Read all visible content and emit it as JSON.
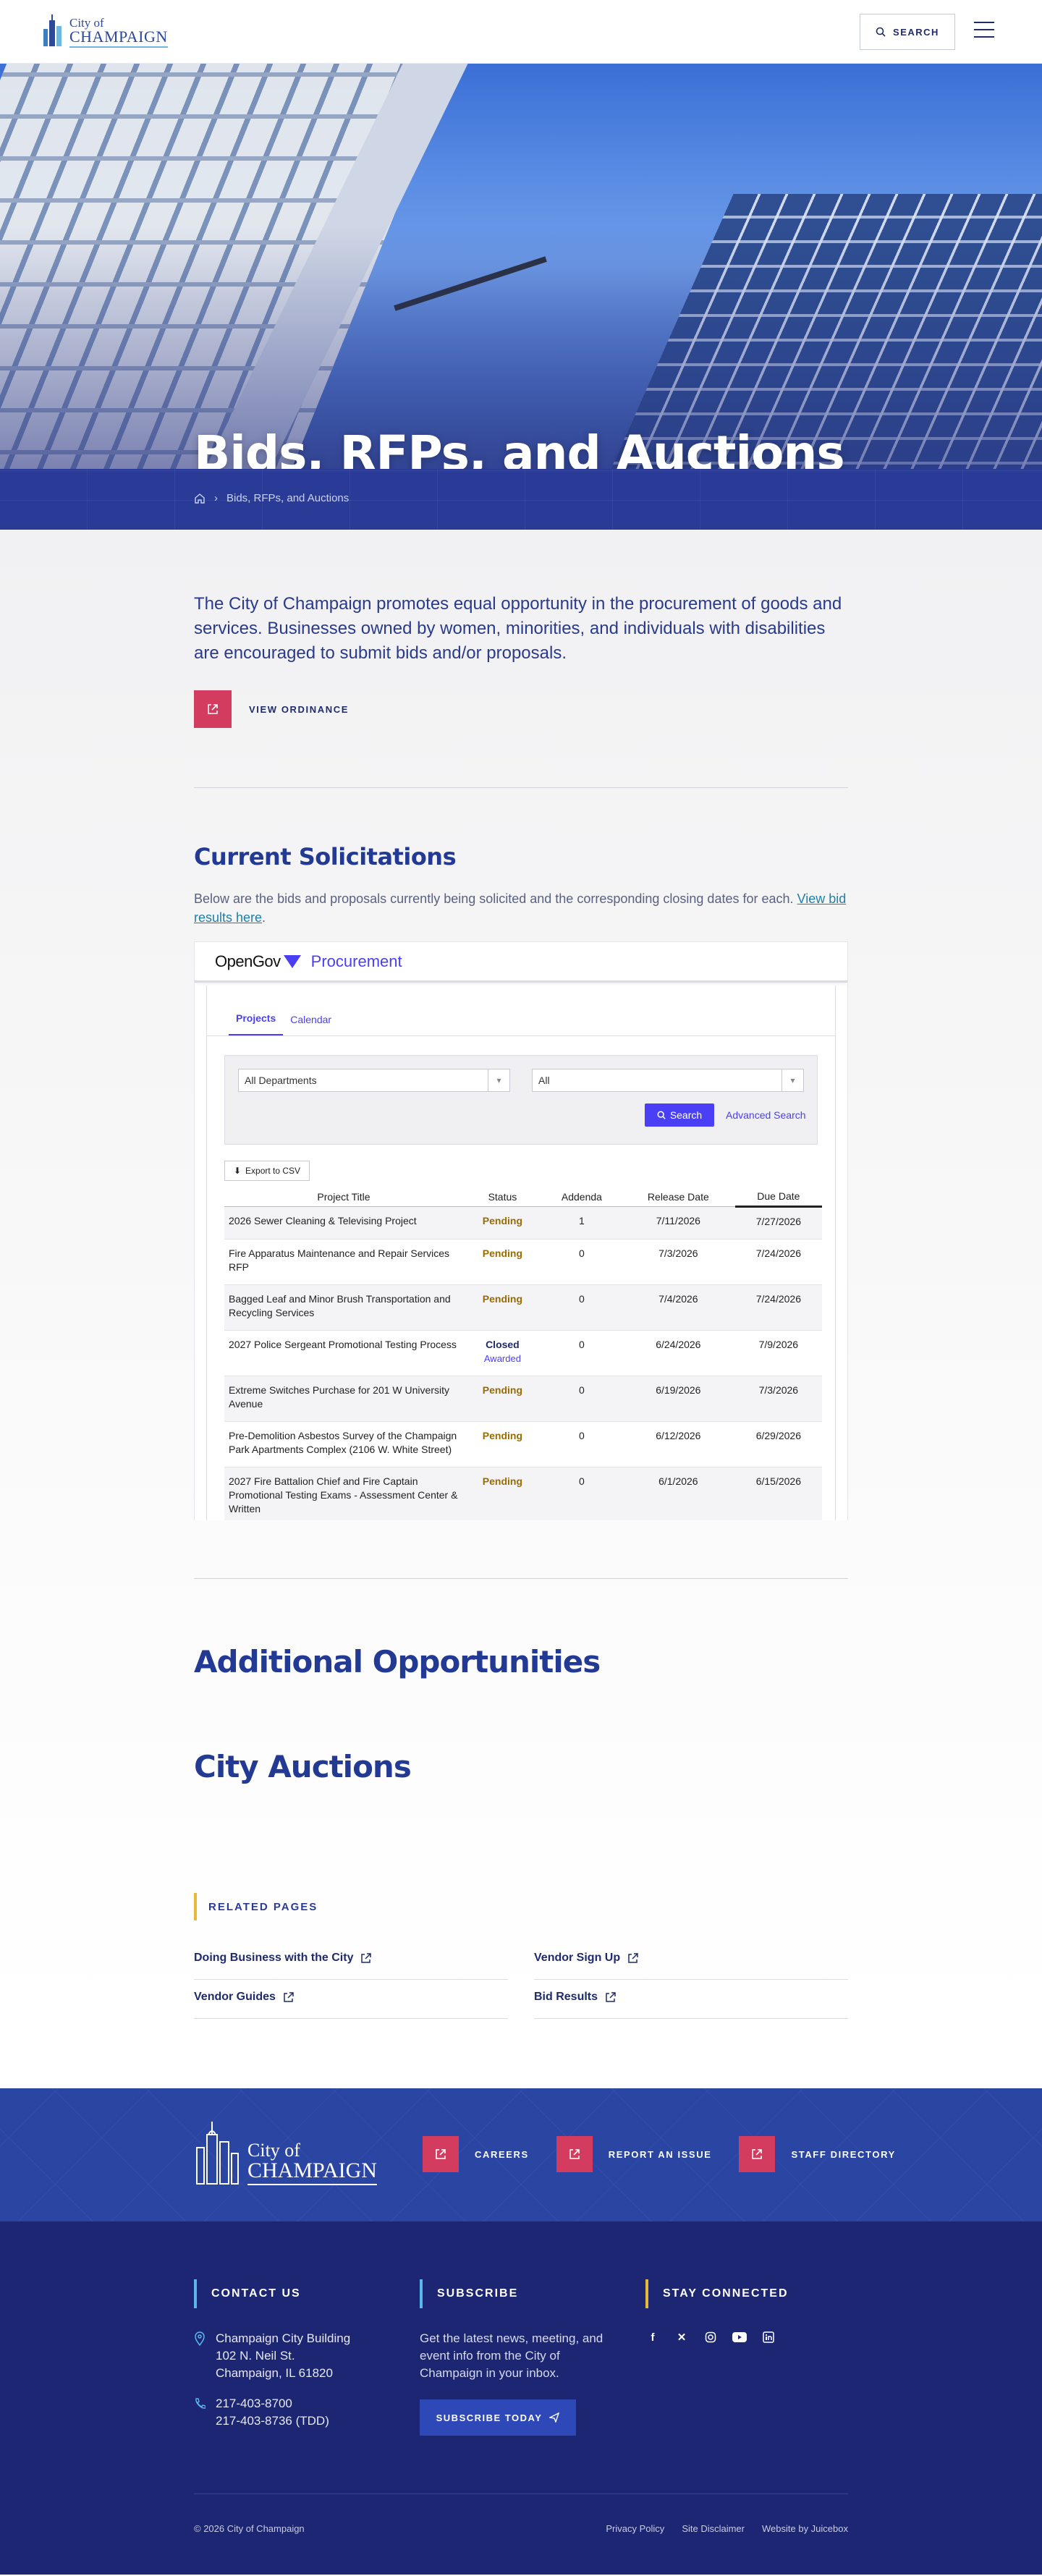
{
  "header": {
    "logo_city": "City of",
    "logo_name": "CHAMPAIGN",
    "search_label": "SEARCH",
    "menu_icon": "hamburger-icon"
  },
  "hero": {
    "title": "Bids, RFPs, and Auctions"
  },
  "breadcrumb": {
    "home_icon": "home-icon",
    "current": "Bids, RFPs, and Auctions"
  },
  "intro": {
    "text": "The City of Champaign promotes equal opportunity in the procurement of goods and services. Businesses owned by women, minorities, and individuals with disabilities are encouraged to submit bids and/or proposals.",
    "ordinance_label": "VIEW ORDINANCE"
  },
  "solicitations": {
    "title": "Current Solicitations",
    "text_before": "Below are the bids and proposals currently being solicited and the corresponding closing dates for each. ",
    "link_text": "View bid results here",
    "text_after": "."
  },
  "opengov": {
    "brand": "OpenGov",
    "product": "Procurement",
    "tabs": [
      "Projects",
      "Calendar"
    ],
    "department_select": "All Departments",
    "status_select": "All",
    "search_label": "Search",
    "advanced_label": "Advanced Search",
    "export_label": "Export to CSV",
    "columns": [
      "Project Title",
      "Status",
      "Addenda",
      "Release Date",
      "Due Date"
    ],
    "rows": [
      {
        "title": "2026 Sewer Cleaning & Televising Project",
        "status": "Pending",
        "sub": "",
        "addenda": "1",
        "release": "7/11/2026",
        "due": "7/27/2026"
      },
      {
        "title": "Fire Apparatus Maintenance and Repair Services RFP",
        "status": "Pending",
        "sub": "",
        "addenda": "0",
        "release": "7/3/2026",
        "due": "7/24/2026"
      },
      {
        "title": "Bagged Leaf and Minor Brush Transportation and Recycling Services",
        "status": "Pending",
        "sub": "",
        "addenda": "0",
        "release": "7/4/2026",
        "due": "7/24/2026"
      },
      {
        "title": "2027 Police Sergeant Promotional Testing Process",
        "status": "Closed",
        "sub": "Awarded",
        "addenda": "0",
        "release": "6/24/2026",
        "due": "7/9/2026"
      },
      {
        "title": "Extreme Switches Purchase for 201 W University Avenue",
        "status": "Pending",
        "sub": "",
        "addenda": "0",
        "release": "6/19/2026",
        "due": "7/3/2026"
      },
      {
        "title": "Pre-Demolition Asbestos Survey of the Champaign Park Apartments Complex (2106 W. White Street)",
        "status": "Pending",
        "sub": "",
        "addenda": "0",
        "release": "6/12/2026",
        "due": "6/29/2026"
      },
      {
        "title": "2027 Fire Battalion Chief and Fire Captain Promotional Testing Exams - Assessment Center & Written",
        "status": "Pending",
        "sub": "",
        "addenda": "0",
        "release": "6/1/2026",
        "due": "6/15/2026"
      }
    ]
  },
  "additional": {
    "title": "Additional Opportunities",
    "auctions_title": "City Auctions"
  },
  "related": {
    "label": "RELATED PAGES",
    "items": [
      "Doing Business with the City",
      "Vendor Sign Up",
      "Vendor Guides",
      "Bid Results"
    ]
  },
  "footer": {
    "logo_city": "City of",
    "logo_name": "CHAMPAIGN",
    "links": [
      "CAREERS",
      "REPORT AN ISSUE",
      "STAFF DIRECTORY"
    ],
    "contact_title": "CONTACT US",
    "address_lines": [
      "Champaign City Building",
      "102 N. Neil St.",
      "Champaign, IL 61820"
    ],
    "phone_lines": [
      "217-403-8700",
      "217-403-8736 (TDD)"
    ],
    "subscribe_title": "SUBSCRIBE",
    "subscribe_text": "Get the latest news, meeting, and event info from the City of Champaign in your inbox.",
    "subscribe_button": "SUBSCRIBE TODAY",
    "connected_title": "STAY CONNECTED",
    "social_icons": [
      "facebook-icon",
      "x-icon",
      "instagram-icon",
      "youtube-icon",
      "linkedin-icon"
    ],
    "copyright": "© 2026 City of Champaign",
    "legal": [
      "Privacy Policy",
      "Site Disclaimer",
      "Website by Juicebox"
    ]
  },
  "colors": {
    "navy": "#1f2b6b",
    "brand_blue": "#233a95",
    "pink": "#d43c5f",
    "gold": "#e8b936",
    "opengov_purple": "#4a3ff5"
  }
}
